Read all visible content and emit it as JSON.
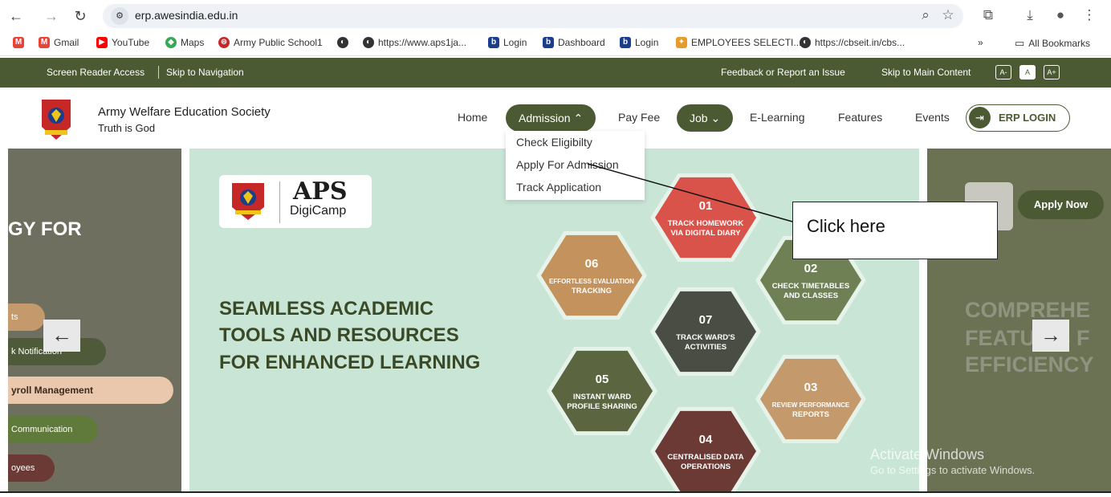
{
  "browser": {
    "url": "erp.awesindia.edu.in",
    "bookmarks": [
      {
        "label": "Gmail",
        "icon": "gmail-icon"
      },
      {
        "label": "YouTube",
        "icon": "youtube-icon"
      },
      {
        "label": "Maps",
        "icon": "maps-icon"
      },
      {
        "label": "Army Public School1",
        "icon": "school-icon"
      },
      {
        "label": "",
        "icon": "globe-icon"
      },
      {
        "label": "https://www.aps1ja...",
        "icon": "globe-icon"
      },
      {
        "label": "Login",
        "icon": "bookmark-site-icon"
      },
      {
        "label": "Dashboard",
        "icon": "bookmark-site-icon"
      },
      {
        "label": "Login",
        "icon": "bookmark-site-icon"
      },
      {
        "label": "EMPLOYEES SELECTI...",
        "icon": "bookmark-site-icon"
      },
      {
        "label": "https://cbseit.in/cbs...",
        "icon": "globe-icon"
      }
    ],
    "more_bookmarks": "»",
    "all_bookmarks": "All Bookmarks"
  },
  "strip": {
    "screen_reader": "Screen Reader Access",
    "skip_nav": "Skip to Navigation",
    "feedback": "Feedback or Report an Issue",
    "skip_main": "Skip to Main Content",
    "size_small": "A-",
    "size_normal": "A",
    "size_large": "A+"
  },
  "header": {
    "org_name": "Army Welfare Education Society",
    "tagline": "Truth is God",
    "nav": {
      "home": "Home",
      "admission": "Admission ⌃",
      "pay_fee": "Pay Fee",
      "job": "Job ⌄",
      "elearning": "E-Learning",
      "features": "Features",
      "events": "Events",
      "erp_login": "ERP LOGIN"
    },
    "admission_menu": [
      "Check Eligibilty",
      "Apply For Admission",
      "Track Application"
    ]
  },
  "carousel": {
    "left_heading": "GY FOR",
    "left_items": [
      "ts",
      "k Notification",
      "yroll Management",
      "Communication",
      "oyees"
    ],
    "aps_title": "APS",
    "aps_sub": "DigiCamp",
    "headline": [
      "SEAMLESS ACADEMIC",
      "TOOLS AND RESOURCES",
      "FOR ENHANCED LEARNING"
    ],
    "hexagons": [
      {
        "num": "01",
        "text": [
          "TRACK HOMEWORK",
          "VIA DIGITAL DIARY"
        ],
        "color": "#d9534a"
      },
      {
        "num": "02",
        "text": [
          "CHECK TIMETABLES",
          "AND CLASSES"
        ],
        "color": "#6e8054"
      },
      {
        "num": "03",
        "text": [
          "REVIEW PERFORMANCE",
          "REPORTS"
        ],
        "color": "#c49a6c"
      },
      {
        "num": "04",
        "text": [
          "CENTRALISED DATA",
          "OPERATIONS"
        ],
        "color": "#6b3a34"
      },
      {
        "num": "05",
        "text": [
          "INSTANT WARD",
          "PROFILE SHARING"
        ],
        "color": "#5b6640"
      },
      {
        "num": "06",
        "text": [
          "EFFORTLESS EVALUATION",
          "TRACKING"
        ],
        "color": "#c4925c"
      },
      {
        "num": "07",
        "text": [
          "TRACK WARD'S",
          "ACTIVITIES"
        ],
        "color": "#4a4d44"
      }
    ],
    "apply_now": "Apply Now",
    "right_lines": [
      "COMPREHE",
      "FEATU ES F",
      "EFFICIENCY"
    ],
    "prev_arrow": "←",
    "next_arrow": "→"
  },
  "overlay": {
    "callout": "Click here",
    "activate_title": "Activate Windows",
    "activate_sub": "Go to Settings to activate Windows."
  }
}
